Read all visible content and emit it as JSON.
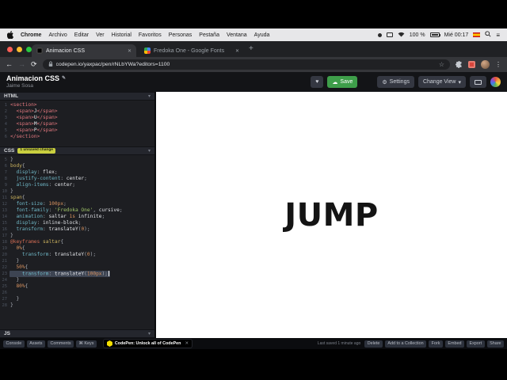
{
  "colors": {
    "save_green": "#3e9e4a",
    "badge_yellow": "#c9cf3f",
    "tag_red": "#e0777d",
    "preview_bg": "#ffffff"
  },
  "icons": {
    "back": "←",
    "forward": "→",
    "reload": "⟳",
    "star": "☆",
    "overflow": "⋮",
    "new_tab": "+",
    "tab_close": "✕",
    "chevron": "▾",
    "heart": "♥",
    "gear": "⚙",
    "cloud": "☁",
    "menu_lines": "≡",
    "pencil": "✎",
    "keys": "⌘"
  },
  "menubar": {
    "items": [
      "Chrome",
      "Archivo",
      "Editar",
      "Ver",
      "Historial",
      "Favoritos",
      "Personas",
      "Pestaña",
      "Ventana",
      "Ayuda"
    ],
    "battery_label": "100 %",
    "clock": "Mié 00:17"
  },
  "browser": {
    "active_tab": "Animacion CSS",
    "inactive_tab": "Fredoka One - Google Fonts",
    "url": "codepen.io/yaxpac/pen/rNLbYWa?editors=1100"
  },
  "pen": {
    "title": "Animacion CSS",
    "author": "Jaime Sosa",
    "buttons": {
      "save": "Save",
      "settings": "Settings",
      "change_view": "Change View"
    }
  },
  "editors": {
    "html": {
      "label": "HTML",
      "lines": [
        {
          "n": "1",
          "t": [
            [
              "tag",
              "<section>"
            ]
          ]
        },
        {
          "n": "2",
          "t": [
            [
              "pu",
              "  "
            ],
            [
              "tag",
              "<span>"
            ],
            [
              "tx",
              "J"
            ],
            [
              "tag",
              "</span>"
            ]
          ]
        },
        {
          "n": "3",
          "t": [
            [
              "pu",
              "  "
            ],
            [
              "tag",
              "<span>"
            ],
            [
              "tx",
              "U"
            ],
            [
              "tag",
              "</span>"
            ]
          ]
        },
        {
          "n": "4",
          "t": [
            [
              "pu",
              "  "
            ],
            [
              "tag",
              "<span>"
            ],
            [
              "tx",
              "M"
            ],
            [
              "tag",
              "</span>"
            ]
          ]
        },
        {
          "n": "5",
          "t": [
            [
              "pu",
              "  "
            ],
            [
              "tag",
              "<span>"
            ],
            [
              "tx",
              "P"
            ],
            [
              "tag",
              "</span>"
            ]
          ]
        },
        {
          "n": "6",
          "t": [
            [
              "tag",
              "</section>"
            ]
          ]
        }
      ]
    },
    "css": {
      "label": "CSS",
      "badge": "1 unsaved change",
      "lines": [
        {
          "n": "5",
          "t": [
            [
              "pu",
              "}"
            ]
          ]
        },
        {
          "n": "6",
          "t": [
            [
              "sel",
              "body"
            ],
            [
              "pu",
              "{"
            ]
          ]
        },
        {
          "n": "7",
          "t": [
            [
              "pu",
              "  "
            ],
            [
              "prop",
              "display"
            ],
            [
              "pu",
              ": "
            ],
            [
              "val",
              "flex"
            ],
            [
              "pu",
              ";"
            ]
          ]
        },
        {
          "n": "8",
          "t": [
            [
              "pu",
              "  "
            ],
            [
              "prop",
              "justify-content"
            ],
            [
              "pu",
              ": "
            ],
            [
              "val",
              "center"
            ],
            [
              "pu",
              ";"
            ]
          ]
        },
        {
          "n": "9",
          "t": [
            [
              "pu",
              "  "
            ],
            [
              "prop",
              "align-items"
            ],
            [
              "pu",
              ": "
            ],
            [
              "val",
              "center"
            ],
            [
              "pu",
              ";"
            ]
          ]
        },
        {
          "n": "10",
          "t": [
            [
              "pu",
              "}"
            ]
          ]
        },
        {
          "n": "11",
          "t": [
            [
              "sel",
              "span"
            ],
            [
              "pu",
              "{"
            ]
          ]
        },
        {
          "n": "12",
          "t": [
            [
              "pu",
              "  "
            ],
            [
              "prop",
              "font-size"
            ],
            [
              "pu",
              ": "
            ],
            [
              "num",
              "100px"
            ],
            [
              "pu",
              ";"
            ]
          ]
        },
        {
          "n": "13",
          "t": [
            [
              "pu",
              "  "
            ],
            [
              "prop",
              "font-family"
            ],
            [
              "pu",
              ": "
            ],
            [
              "str",
              "'Fredoka One'"
            ],
            [
              "pu",
              ", "
            ],
            [
              "val",
              "cursive"
            ],
            [
              "pu",
              ";"
            ]
          ]
        },
        {
          "n": "14",
          "t": [
            [
              "pu",
              "  "
            ],
            [
              "prop",
              "animation"
            ],
            [
              "pu",
              ": "
            ],
            [
              "val",
              "saltar "
            ],
            [
              "num",
              "1s"
            ],
            [
              "val",
              " infinite"
            ],
            [
              "pu",
              ";"
            ]
          ]
        },
        {
          "n": "15",
          "t": [
            [
              "pu",
              "  "
            ],
            [
              "prop",
              "display"
            ],
            [
              "pu",
              ": "
            ],
            [
              "val",
              "inline-block"
            ],
            [
              "pu",
              ";"
            ]
          ]
        },
        {
          "n": "16",
          "t": [
            [
              "pu",
              "  "
            ],
            [
              "prop",
              "transform"
            ],
            [
              "pu",
              ": "
            ],
            [
              "fn",
              "translateY"
            ],
            [
              "pu",
              "("
            ],
            [
              "num",
              "0"
            ],
            [
              "pu",
              ");"
            ]
          ]
        },
        {
          "n": "17",
          "t": [
            [
              "pu",
              "}"
            ]
          ]
        },
        {
          "n": "18",
          "t": [
            [
              "at",
              "@keyframes"
            ],
            [
              "sel",
              " saltar"
            ],
            [
              "pu",
              "{"
            ]
          ]
        },
        {
          "n": "19",
          "t": [
            [
              "pu",
              "  "
            ],
            [
              "num",
              "0%"
            ],
            [
              "pu",
              "{"
            ]
          ]
        },
        {
          "n": "20",
          "t": [
            [
              "pu",
              "    "
            ],
            [
              "prop",
              "transform"
            ],
            [
              "pu",
              ": "
            ],
            [
              "fn",
              "translateY"
            ],
            [
              "pu",
              "("
            ],
            [
              "num",
              "0"
            ],
            [
              "pu",
              ");"
            ]
          ]
        },
        {
          "n": "21",
          "t": [
            [
              "pu",
              "  }"
            ]
          ]
        },
        {
          "n": "22",
          "t": [
            [
              "pu",
              "  "
            ],
            [
              "num",
              "50%"
            ],
            [
              "pu",
              "{"
            ]
          ]
        },
        {
          "n": "23",
          "hl": true,
          "cursor": true,
          "t": [
            [
              "pu",
              "    "
            ],
            [
              "prop",
              "transform"
            ],
            [
              "pu",
              ": "
            ],
            [
              "fn",
              "translateY"
            ],
            [
              "pu",
              "("
            ],
            [
              "num",
              "100px"
            ],
            [
              "pu",
              ");"
            ]
          ]
        },
        {
          "n": "24",
          "t": [
            [
              "pu",
              "  }"
            ]
          ]
        },
        {
          "n": "25",
          "t": [
            [
              "pu",
              "  "
            ],
            [
              "num",
              "80%"
            ],
            [
              "pu",
              "{"
            ]
          ]
        },
        {
          "n": "26",
          "t": []
        },
        {
          "n": "27",
          "t": [
            [
              "pu",
              "  }"
            ]
          ]
        },
        {
          "n": "28",
          "t": [
            [
              "pu",
              "}"
            ]
          ]
        }
      ]
    },
    "js": {
      "label": "JS"
    }
  },
  "preview": {
    "text": "JUMP"
  },
  "footer": {
    "chips_left": [
      "Console",
      "Assets",
      "Comments",
      "⌘ Keys"
    ],
    "ad_text": "CodePen: Unlock all of CodePen",
    "ad_close": "✕",
    "saved": "Last saved 1 minute ago",
    "chips_right": [
      "Delete",
      "Add to a Collection",
      "Fork",
      "Embed",
      "Export",
      "Share"
    ]
  }
}
